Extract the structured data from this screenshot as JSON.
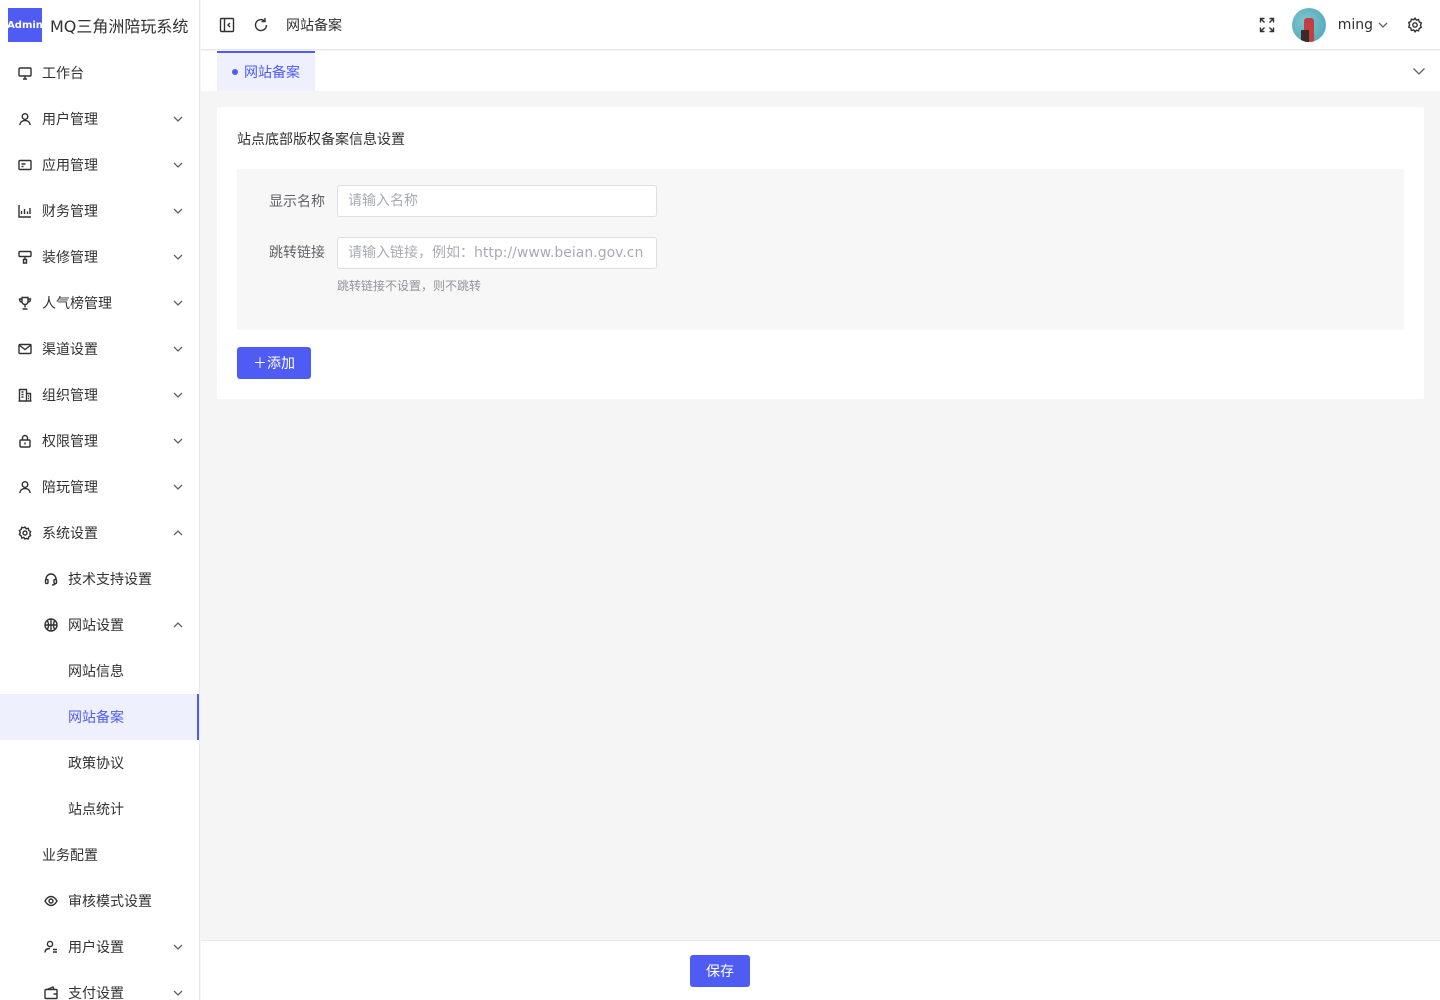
{
  "app": {
    "badge": "Admin",
    "title": "MQ三角洲陪玩系统"
  },
  "sidebar": {
    "items": [
      {
        "label": "工作台",
        "icon": "monitor-icon"
      },
      {
        "label": "用户管理",
        "icon": "user-icon"
      },
      {
        "label": "应用管理",
        "icon": "app-icon"
      },
      {
        "label": "财务管理",
        "icon": "chart-icon"
      },
      {
        "label": "装修管理",
        "icon": "brush-icon"
      },
      {
        "label": "人气榜管理",
        "icon": "trophy-icon"
      },
      {
        "label": "渠道设置",
        "icon": "mail-icon"
      },
      {
        "label": "组织管理",
        "icon": "building-icon"
      },
      {
        "label": "权限管理",
        "icon": "lock-icon"
      },
      {
        "label": "陪玩管理",
        "icon": "user-icon"
      },
      {
        "label": "系统设置",
        "icon": "gear-icon"
      }
    ],
    "sub": {
      "tech_support": "技术支持设置",
      "website_settings": "网站设置",
      "website_info": "网站信息",
      "website_icp": "网站备案",
      "policy": "政策协议",
      "site_stats": "站点统计",
      "business_config": "业务配置",
      "review_mode": "审核模式设置",
      "user_settings": "用户设置",
      "payment_settings": "支付设置"
    }
  },
  "header": {
    "breadcrumb": "网站备案",
    "username": "ming"
  },
  "tabs": {
    "active": "网站备案"
  },
  "card": {
    "title": "站点底部版权备案信息设置",
    "fields": {
      "name_label": "显示名称",
      "name_placeholder": "请输入名称",
      "link_label": "跳转链接",
      "link_placeholder": "请输入链接，例如：http://www.beian.gov.cn",
      "link_hint": "跳转链接不设置，则不跳转"
    },
    "add_button": "＋添加"
  },
  "footer": {
    "save_button": "保存"
  },
  "colors": {
    "primary": "#4e5cf3",
    "active_bg": "#eef0fe"
  }
}
